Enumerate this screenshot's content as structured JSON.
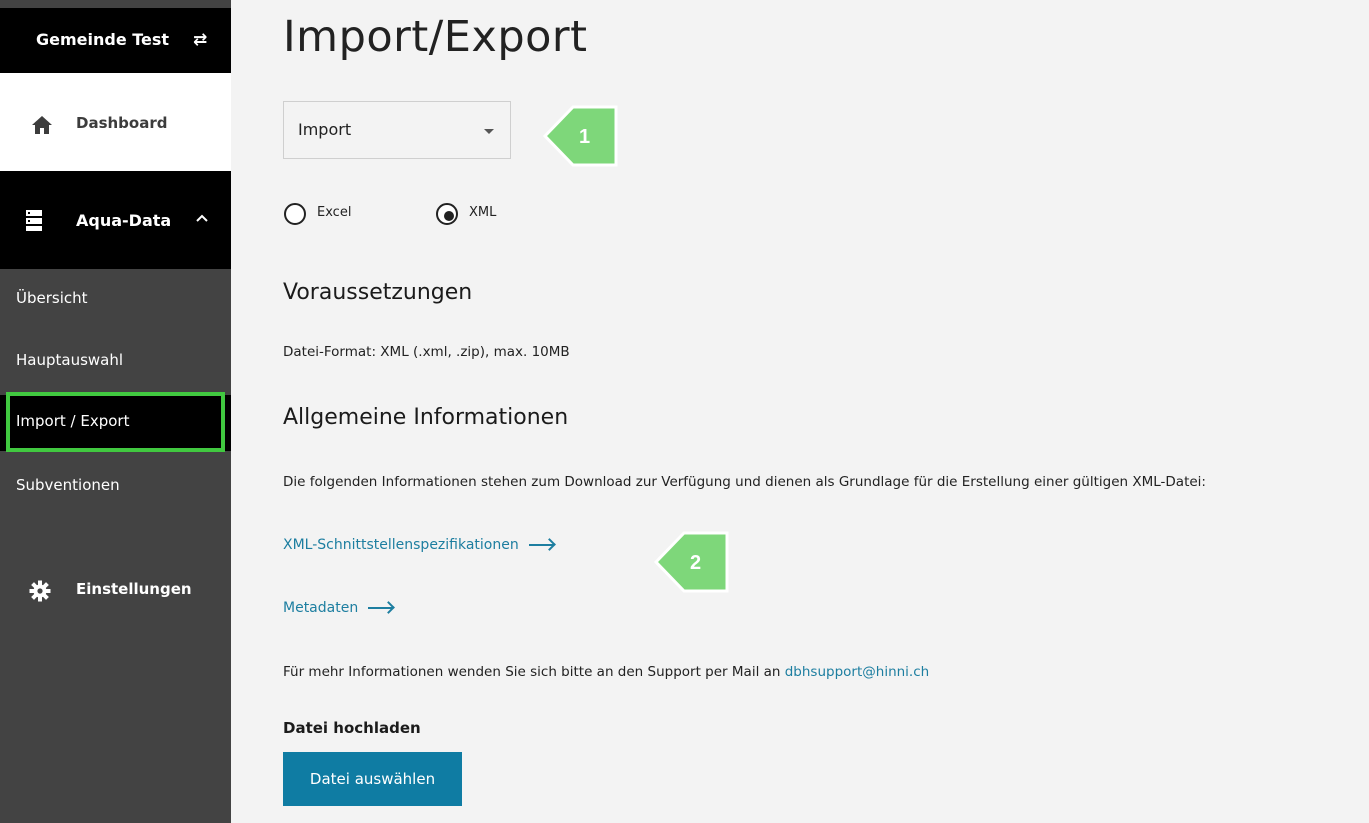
{
  "sidebar": {
    "tenant": {
      "name": "Gemeinde Test",
      "icon": "swap-arrows-icon"
    },
    "dashboard": {
      "label": "Dashboard",
      "icon": "home-icon"
    },
    "group": {
      "label": "Aqua-Data",
      "icon": "server-icon",
      "expanded": true
    },
    "subitems": [
      {
        "label": "Übersicht",
        "active": false
      },
      {
        "label": "Hauptauswahl",
        "active": false
      },
      {
        "label": "Import / Export",
        "active": true
      },
      {
        "label": "Subventionen",
        "active": false
      }
    ],
    "settings": {
      "label": "Einstellungen",
      "icon": "gear-icon"
    }
  },
  "main": {
    "title": "Import/Export",
    "mode_select": {
      "value": "Import"
    },
    "format": {
      "options": [
        {
          "label": "Excel",
          "checked": false
        },
        {
          "label": "XML",
          "checked": true
        }
      ]
    },
    "requirements": {
      "heading": "Voraussetzungen",
      "text": "Datei-Format: XML (.xml, .zip), max. 10MB"
    },
    "info": {
      "heading": "Allgemeine Informationen",
      "text": "Die folgenden Informationen stehen zum Download zur Verfügung und dienen als Grundlage für die Erstellung einer gültigen XML-Datei:",
      "links": [
        {
          "label": "XML-Schnittstellenspezifikationen"
        },
        {
          "label": "Metadaten"
        }
      ],
      "support_prefix": "Für mehr Informationen wenden Sie sich bitte an den Support per Mail an ",
      "support_email": "dbhsupport@hinni.ch"
    },
    "upload": {
      "label": "Datei hochladen",
      "button": "Datei auswählen"
    }
  },
  "annotations": {
    "markers": [
      "1",
      "2"
    ],
    "color": "#7ed77a",
    "highlight_color": "#41c940"
  },
  "colors": {
    "link": "#1d7ea0",
    "button": "#0f7ca3"
  }
}
